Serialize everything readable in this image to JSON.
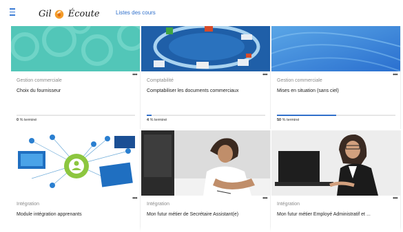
{
  "header": {
    "logo_text_1": "Gil",
    "logo_text_2": "Écoute",
    "nav_link": "Listes des cours"
  },
  "cards": [
    {
      "category": "Gestion commerciale",
      "title": "Choix du fournisseur",
      "progress_value": "0",
      "progress_suffix": " % terminé",
      "progress": 0
    },
    {
      "category": "Comptabilité",
      "title": "Comptabiliser les documents commerciaux",
      "progress_value": "4",
      "progress_suffix": " % terminé",
      "progress": 4
    },
    {
      "category": "Gestion commerciale",
      "title": "Mises en situation (sans ciel)",
      "progress_value": "50",
      "progress_suffix": " % terminé",
      "progress": 50
    },
    {
      "category": "Intégration",
      "title": "Module intégration apprenants"
    },
    {
      "category": "Intégration",
      "title": "Mon futur métier de Secrétaire Assistant(e)"
    },
    {
      "category": "Intégration",
      "title": "Mon futur métier Employé Administratif et ..."
    }
  ],
  "card_menu_glyph": "•••",
  "colors": {
    "accent": "#2f6fcb",
    "teal": "#4ec3b5",
    "blue": "#3c86d6"
  }
}
